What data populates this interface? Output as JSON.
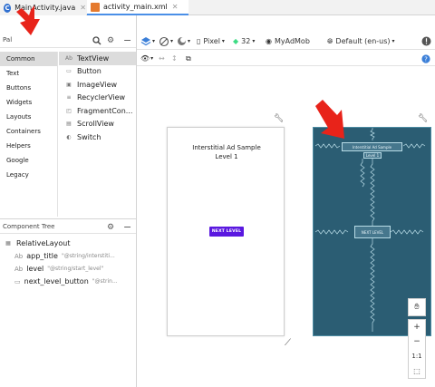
{
  "tabs": [
    {
      "label": "MainActivity.java",
      "icon": "java-class-icon",
      "active": false
    },
    {
      "label": "activity_main.xml",
      "icon": "xml-layout-icon",
      "active": true
    }
  ],
  "palette": {
    "title": "Pal",
    "categories": [
      "Common",
      "Text",
      "Buttons",
      "Widgets",
      "Layouts",
      "Containers",
      "Helpers",
      "Google",
      "Legacy"
    ],
    "selected_category": "Common",
    "widgets": [
      {
        "label": "TextView",
        "icon": "Ab"
      },
      {
        "label": "Button",
        "icon": "▭"
      },
      {
        "label": "ImageView",
        "icon": "▣"
      },
      {
        "label": "RecyclerView",
        "icon": "≡"
      },
      {
        "label": "FragmentCon...",
        "icon": "◰"
      },
      {
        "label": "ScrollView",
        "icon": "▤"
      },
      {
        "label": "Switch",
        "icon": "◐"
      }
    ]
  },
  "component_tree": {
    "title": "Component Tree",
    "root": "RelativeLayout",
    "children": [
      {
        "icon": "Ab",
        "label": "app_title",
        "attr": "\"@string/interstiti..."
      },
      {
        "icon": "Ab",
        "label": "level",
        "attr": "\"@string/start_level\""
      },
      {
        "icon": "▭",
        "label": "next_level_button",
        "attr": "\"@strin..."
      }
    ]
  },
  "toolbar": {
    "device": "Pixel",
    "api": "32",
    "theme": "MyAdMob",
    "locale": "Default (en-us)"
  },
  "preview": {
    "app_title_line1": "Interstitial Ad Sample",
    "app_title_line2": "Level 1",
    "next_button": "NEXT LEVEL",
    "blueprint_title": "Interstitial Ad Sample",
    "blueprint_level": "Level 1",
    "blueprint_button": "NEXT LEVEL"
  },
  "zoom": {
    "plus": "+",
    "minus": "−",
    "ratio": "1:1"
  },
  "colors": {
    "blueprint_bg": "#2b5d73",
    "button_purple": "#5a18e0",
    "arrow_red": "#e8231a",
    "active_tab_underline": "#4a8fe7"
  }
}
